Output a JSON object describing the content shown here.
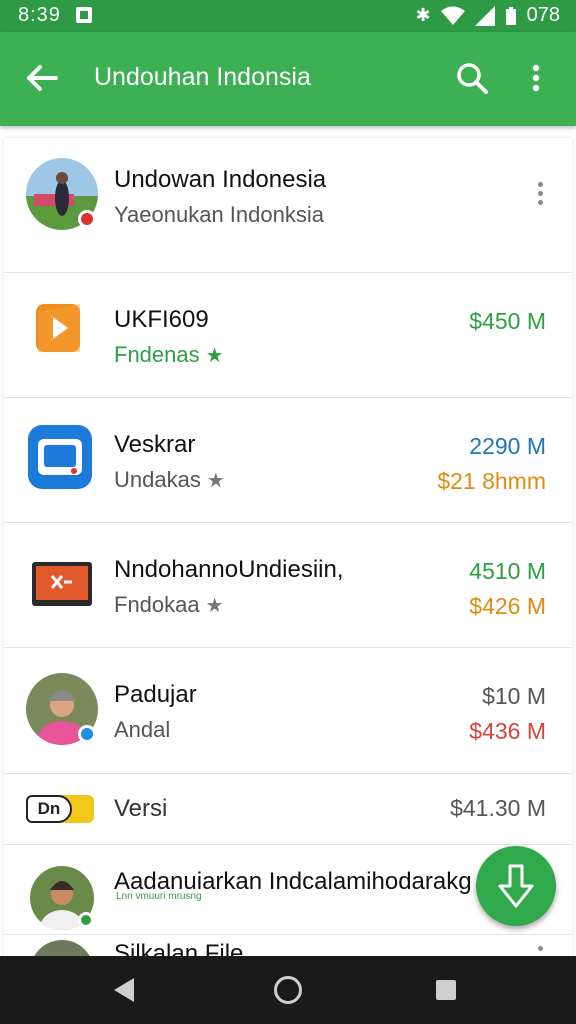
{
  "status_bar": {
    "time": "8:39",
    "battery": "078"
  },
  "app_bar": {
    "title": "Undouhan Indonsia",
    "back_icon": "arrow-left-icon",
    "search_icon": "search-icon",
    "more_icon": "more-vert-icon"
  },
  "colors": {
    "status_bar": "#2e9a45",
    "app_bar": "#3db054",
    "green": "#2ea043",
    "blue": "#1e77b5",
    "orange": "#e08b10",
    "red": "#d8443c",
    "gray": "#555555",
    "fab": "#30a84c"
  },
  "rows": [
    {
      "name": "Undowan Indonesia",
      "subtitle": "Yaeonukan Indonksia",
      "icon": "profile-photo-avatar"
    },
    {
      "name": "UKFI609",
      "subtitle": "Fndenas",
      "value1": "$450 M",
      "icon": "orange-play-app-icon"
    },
    {
      "name": "Veskrar",
      "subtitle": "Undakas",
      "value1": "2290 M",
      "value2": "$21 8hmm",
      "icon": "blue-screen-app-icon"
    },
    {
      "name": "NndohannoUndiesiin,",
      "subtitle": "Fndokaa",
      "value1": "4510 M",
      "value2": "$426 M",
      "icon": "orange-tv-app-icon"
    },
    {
      "name": "Padujar",
      "subtitle": "Andal",
      "value1": "$10 M",
      "value2": "$436 M",
      "icon": "profile-photo-avatar"
    },
    {
      "name": "Versi",
      "value1": "$41.30 M",
      "icon": "version-badge-icon",
      "badge_text": "Dn"
    },
    {
      "name": "Aadanuiarkan Indcalamihodarakg",
      "subtitle": "Lnn vmuuri mrusng",
      "icon": "profile-photo-avatar"
    },
    {
      "name": "Silkalan File",
      "icon": "profile-photo-avatar"
    }
  ],
  "fab": {
    "icon": "download-arrow-icon"
  },
  "nav_bar": {
    "back": "back-triangle-icon",
    "home": "home-circle-icon",
    "recents": "recents-square-icon"
  }
}
